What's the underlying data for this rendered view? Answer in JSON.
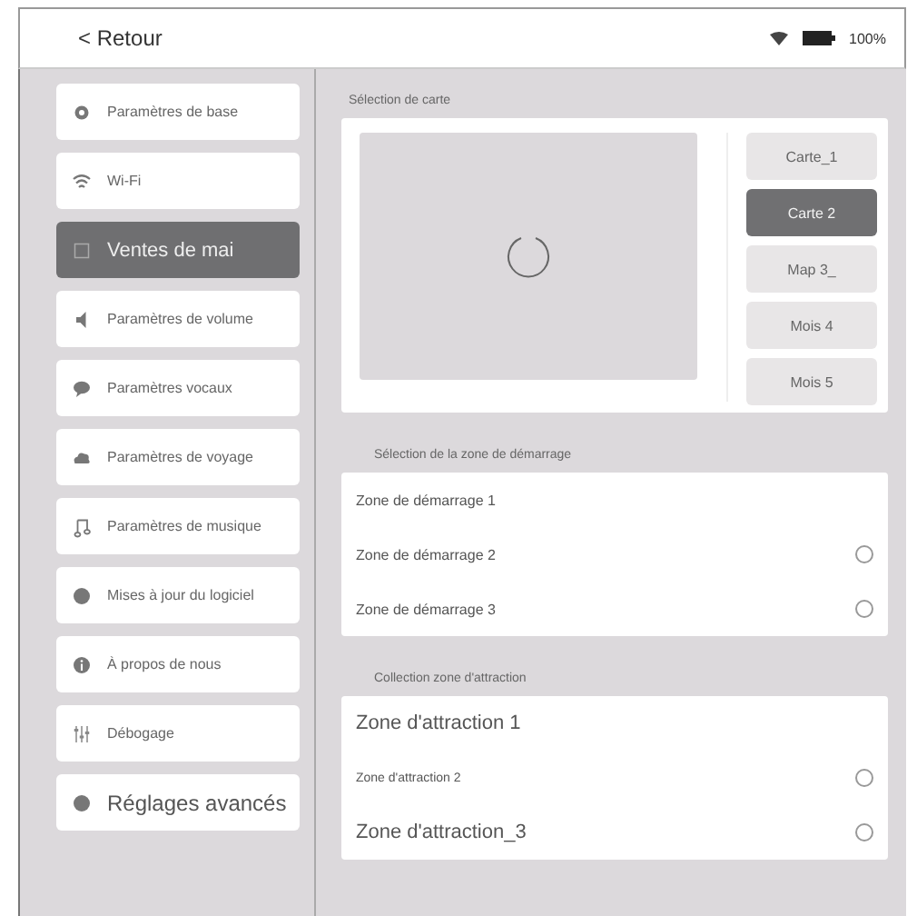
{
  "top_bar": {
    "back": "< Retour",
    "battery": "100%"
  },
  "sidebar": {
    "items": [
      {
        "label": "Paramètres de base",
        "selected": false
      },
      {
        "label": "Wi-Fi",
        "selected": false
      },
      {
        "label": "Ventes de mai",
        "selected": true
      },
      {
        "label": "Paramètres de volume",
        "selected": false
      },
      {
        "label": "Paramètres vocaux",
        "selected": false
      },
      {
        "label": "Paramètres de voyage",
        "selected": false
      },
      {
        "label": "Paramètres de musique",
        "selected": false
      },
      {
        "label": "Mises à jour du logiciel",
        "selected": false
      },
      {
        "label": "À propos de nous",
        "selected": false
      },
      {
        "label": "Débogage",
        "selected": false
      },
      {
        "label": "Réglages avancés",
        "selected": false
      }
    ]
  },
  "map_selection": {
    "title": "Sélection de carte",
    "maps": [
      {
        "label": "Carte_1",
        "selected": false
      },
      {
        "label": "Carte 2",
        "selected": true
      },
      {
        "label": "Map 3_",
        "selected": false
      },
      {
        "label": "Mois 4",
        "selected": false
      },
      {
        "label": "Mois 5",
        "selected": false
      }
    ]
  },
  "start_zone": {
    "title": "Sélection de la zone de démarrage",
    "rows": [
      {
        "label": "Zone de démarrage 1",
        "kind": "plain",
        "selected": false
      },
      {
        "label": "Zone de démarrage 2",
        "kind": "radio",
        "selected": false
      },
      {
        "label": "Zone de démarrage 3",
        "kind": "radio",
        "selected": false
      }
    ]
  },
  "attraction_zone": {
    "title": "Collection zone d'attraction",
    "rows": [
      {
        "label": "Zone d'attraction 1",
        "kind": "plain",
        "selected": false
      },
      {
        "label": "Zone d'attraction 2",
        "kind": "radio",
        "selected": false
      },
      {
        "label": "Zone d'attraction_3",
        "kind": "radio",
        "selected": false
      }
    ]
  }
}
